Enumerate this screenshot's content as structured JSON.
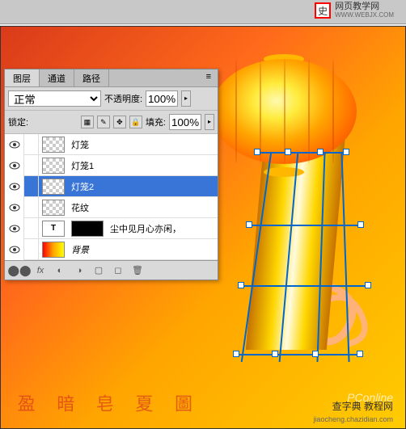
{
  "topbar": {
    "logo_char": "史",
    "site_name": "网页教学网",
    "site_url": "WWW.WEBJX.COM"
  },
  "panel": {
    "tabs": {
      "layers": "图层",
      "channels": "通道",
      "paths": "路径"
    },
    "blend_mode": "正常",
    "opacity_label": "不透明度:",
    "opacity_value": "100%",
    "lock_label": "锁定:",
    "fill_label": "填充:",
    "fill_value": "100%",
    "layers": [
      {
        "name": "灯笼",
        "type": "raster"
      },
      {
        "name": "灯笼1",
        "type": "raster"
      },
      {
        "name": "灯笼2",
        "type": "raster",
        "selected": true
      },
      {
        "name": "花纹",
        "type": "raster"
      },
      {
        "name": "尘中见月心亦闲，",
        "type": "text"
      },
      {
        "name": "背景",
        "type": "background"
      }
    ]
  },
  "decorative_text": [
    "盈",
    "暗",
    "皂",
    "夏",
    "圖"
  ],
  "watermarks": {
    "pconline": "PConline",
    "site": "查字典 教程网",
    "site_url": "jiaocheng.chazidian.com"
  }
}
